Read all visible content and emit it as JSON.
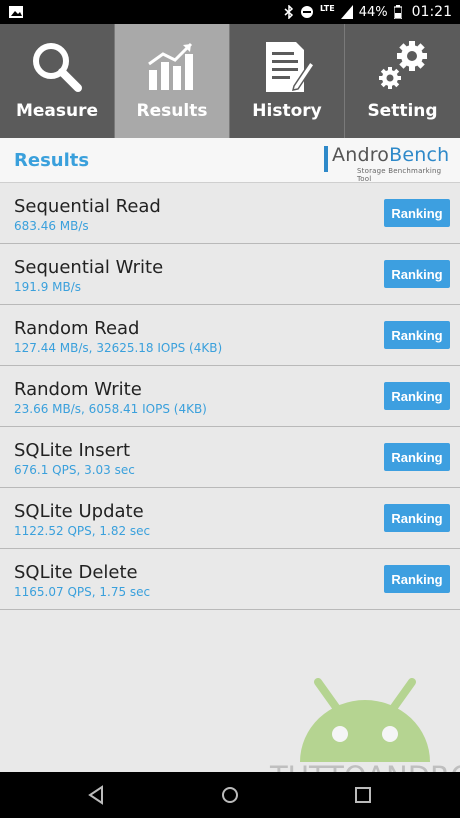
{
  "status_bar": {
    "signal_label": "LTE",
    "battery": "44%",
    "time": "01:21"
  },
  "tabs": [
    {
      "label": "Measure",
      "icon": "search-icon"
    },
    {
      "label": "Results",
      "icon": "results-chart-icon"
    },
    {
      "label": "History",
      "icon": "history-document-icon"
    },
    {
      "label": "Setting",
      "icon": "gear-icon"
    }
  ],
  "header": {
    "title": "Results",
    "logo_word": "AndroBench",
    "logo_sub": "Storage Benchmarking Tool"
  },
  "results": [
    {
      "name": "Sequential Read",
      "value": "683.46 MB/s",
      "button": "Ranking"
    },
    {
      "name": "Sequential Write",
      "value": "191.9 MB/s",
      "button": "Ranking"
    },
    {
      "name": "Random Read",
      "value": "127.44 MB/s, 32625.18 IOPS (4KB)",
      "button": "Ranking"
    },
    {
      "name": "Random Write",
      "value": "23.66 MB/s, 6058.41 IOPS (4KB)",
      "button": "Ranking"
    },
    {
      "name": "SQLite Insert",
      "value": "676.1 QPS, 3.03 sec",
      "button": "Ranking"
    },
    {
      "name": "SQLite Update",
      "value": "1122.52 QPS, 1.82 sec",
      "button": "Ranking"
    },
    {
      "name": "SQLite Delete",
      "value": "1165.07 QPS, 1.75 sec",
      "button": "Ranking"
    }
  ],
  "watermark": {
    "text": "TUTTOANDROID"
  },
  "colors": {
    "accent": "#3aa0dc",
    "button": "#3d9fe0",
    "tab_bg": "#5b5b5b",
    "tab_active": "#a9a9a9"
  }
}
